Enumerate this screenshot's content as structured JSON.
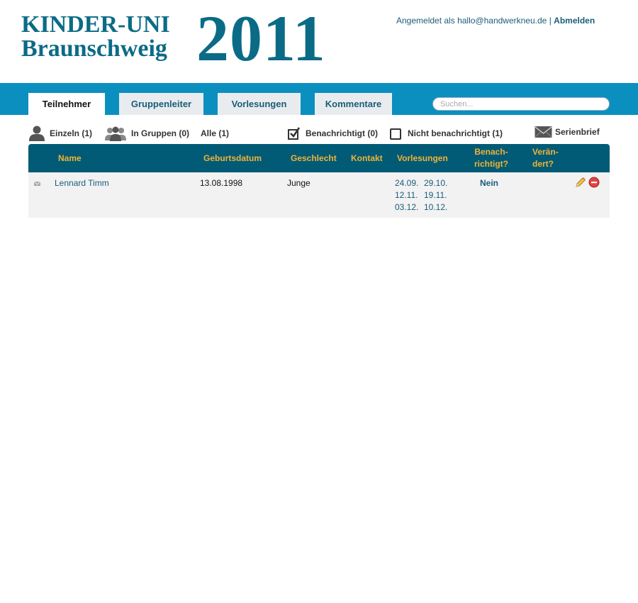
{
  "header": {
    "logo_line1": "KINDER-UNI",
    "logo_line2": "Braunschweig",
    "logo_year": "2011",
    "account_prefix": "Angemeldet als",
    "account_email": "hallo@handwerkneu.de",
    "account_separator": "|",
    "logout_label": "Abmelden"
  },
  "nav": {
    "tabs": [
      {
        "label": "Teilnehmer",
        "active": true
      },
      {
        "label": "Gruppenleiter",
        "active": false
      },
      {
        "label": "Vorlesungen",
        "active": false
      },
      {
        "label": "Kommentare",
        "active": false
      }
    ],
    "search_placeholder": "Suchen..."
  },
  "filters": {
    "einzeln": "Einzeln (1)",
    "gruppen": "In Gruppen (0)",
    "alle": "Alle (1)",
    "benachrichtigt": "Benachrichtigt (0)",
    "nicht_benachrichtigt": "Nicht benachrichtigt (1)",
    "serienbrief": "Serienbrief"
  },
  "table": {
    "headers": {
      "name": "Name",
      "birthdate": "Geburtsdatum",
      "gender": "Geschlecht",
      "contact": "Kontakt",
      "lectures": "Vorlesungen",
      "notified_1": "Benach-",
      "notified_2": "richtigt?",
      "changed_1": "Verän-",
      "changed_2": "dert?"
    },
    "rows": [
      {
        "name": "Lennard Timm",
        "birthdate": "13.08.1998",
        "gender": "Junge",
        "contact": "",
        "lectures": [
          "24.09.",
          "29.10.",
          "12.11.",
          "19.11.",
          "03.12.",
          "10.12."
        ],
        "notified": "Nein",
        "changed": ""
      }
    ]
  },
  "colors": {
    "brand": "#0b6b86",
    "navbar": "#0a8fbf",
    "table_header": "#015b76",
    "header_text": "#f2b235",
    "link": "#1a5c7a"
  },
  "icons": [
    "person-icon",
    "group-icon",
    "checkbox-checked-icon",
    "checkbox-empty-icon",
    "envelope-icon",
    "mail-small-icon",
    "pencil-icon",
    "delete-icon"
  ]
}
